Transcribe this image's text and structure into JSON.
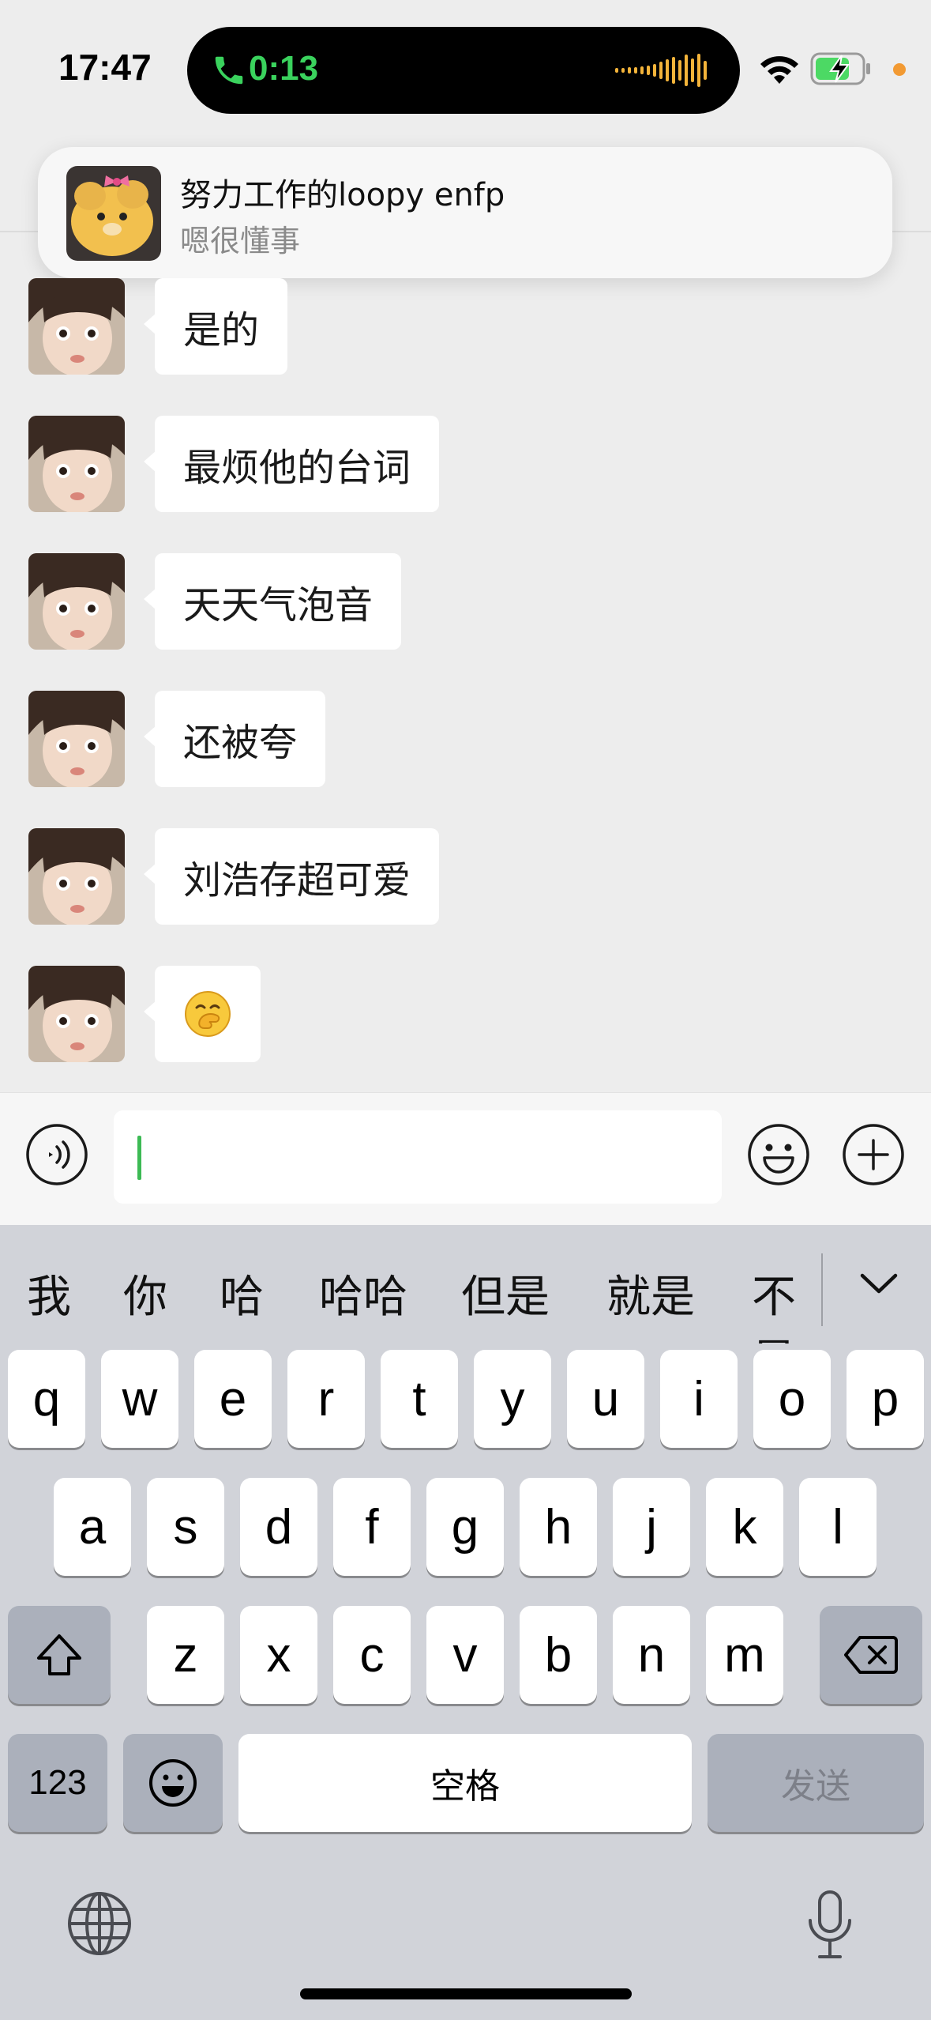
{
  "status_bar": {
    "time": "17:47",
    "call_timer": "0:13",
    "call_color": "#3ad25d"
  },
  "notification": {
    "title": "努力工作的loopy enfp",
    "message": "嗯很懂事"
  },
  "messages": [
    {
      "text": "是的"
    },
    {
      "text": "最烦他的台词"
    },
    {
      "text": "天天气泡音"
    },
    {
      "text": "还被夸"
    },
    {
      "text": "刘浩存超可爱"
    },
    {
      "text": "🤭"
    }
  ],
  "input": {
    "value": ""
  },
  "keyboard": {
    "candidates": [
      "我",
      "你",
      "哈",
      "哈哈",
      "但是",
      "就是",
      "不是"
    ],
    "row1": [
      "q",
      "w",
      "e",
      "r",
      "t",
      "y",
      "u",
      "i",
      "o",
      "p"
    ],
    "row2": [
      "a",
      "s",
      "d",
      "f",
      "g",
      "h",
      "j",
      "k",
      "l"
    ],
    "row3": [
      "z",
      "x",
      "c",
      "v",
      "b",
      "n",
      "m"
    ],
    "numbers_key": "123",
    "space_key": "空格",
    "send_key": "发送"
  },
  "colors": {
    "background": "#ededed",
    "bubble": "#ffffff",
    "keyboard": "#d1d3d9",
    "cursor": "#3cba54"
  }
}
